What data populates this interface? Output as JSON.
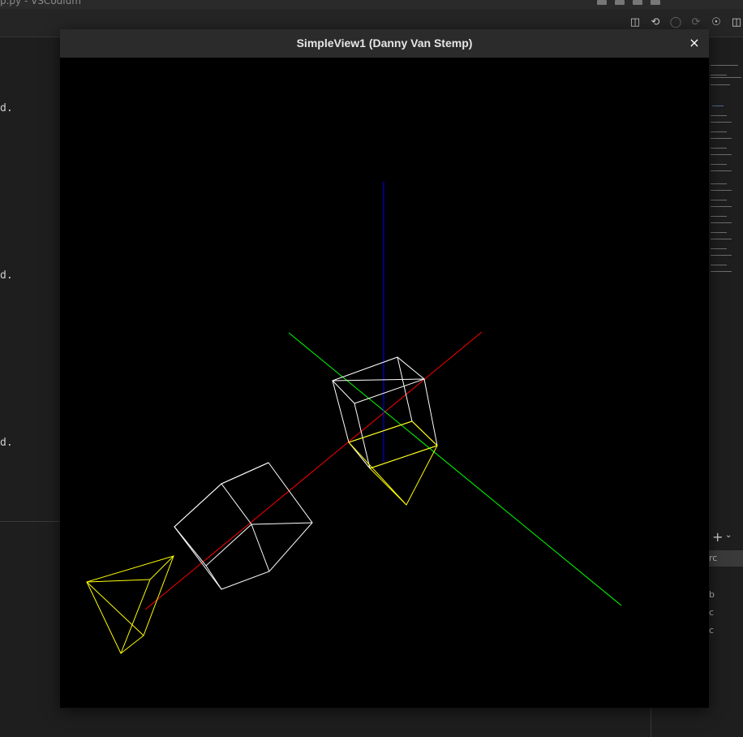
{
  "background_editor": {
    "title_fragment": "p.py - VSCodium",
    "left_lines": [
      "d.",
      "d.",
      "d."
    ],
    "right_panel_rows": [
      "b",
      "c",
      "c"
    ],
    "search_text": "rc",
    "icons": [
      "split-editor-icon",
      "go-back-icon",
      "circle-icon",
      "forward-icon",
      "debug-icon",
      "layout-icon"
    ]
  },
  "window": {
    "title": "SimpleView1 (Danny Van Stemp)",
    "close_label": "×"
  },
  "scene": {
    "background_color": "#000000",
    "axis_colors": {
      "x": "#ff0000",
      "y": "#00ff00",
      "z": "#0000ff"
    },
    "object_colors": {
      "cube": "#ffffff",
      "pyramid": "#ffff00"
    }
  }
}
